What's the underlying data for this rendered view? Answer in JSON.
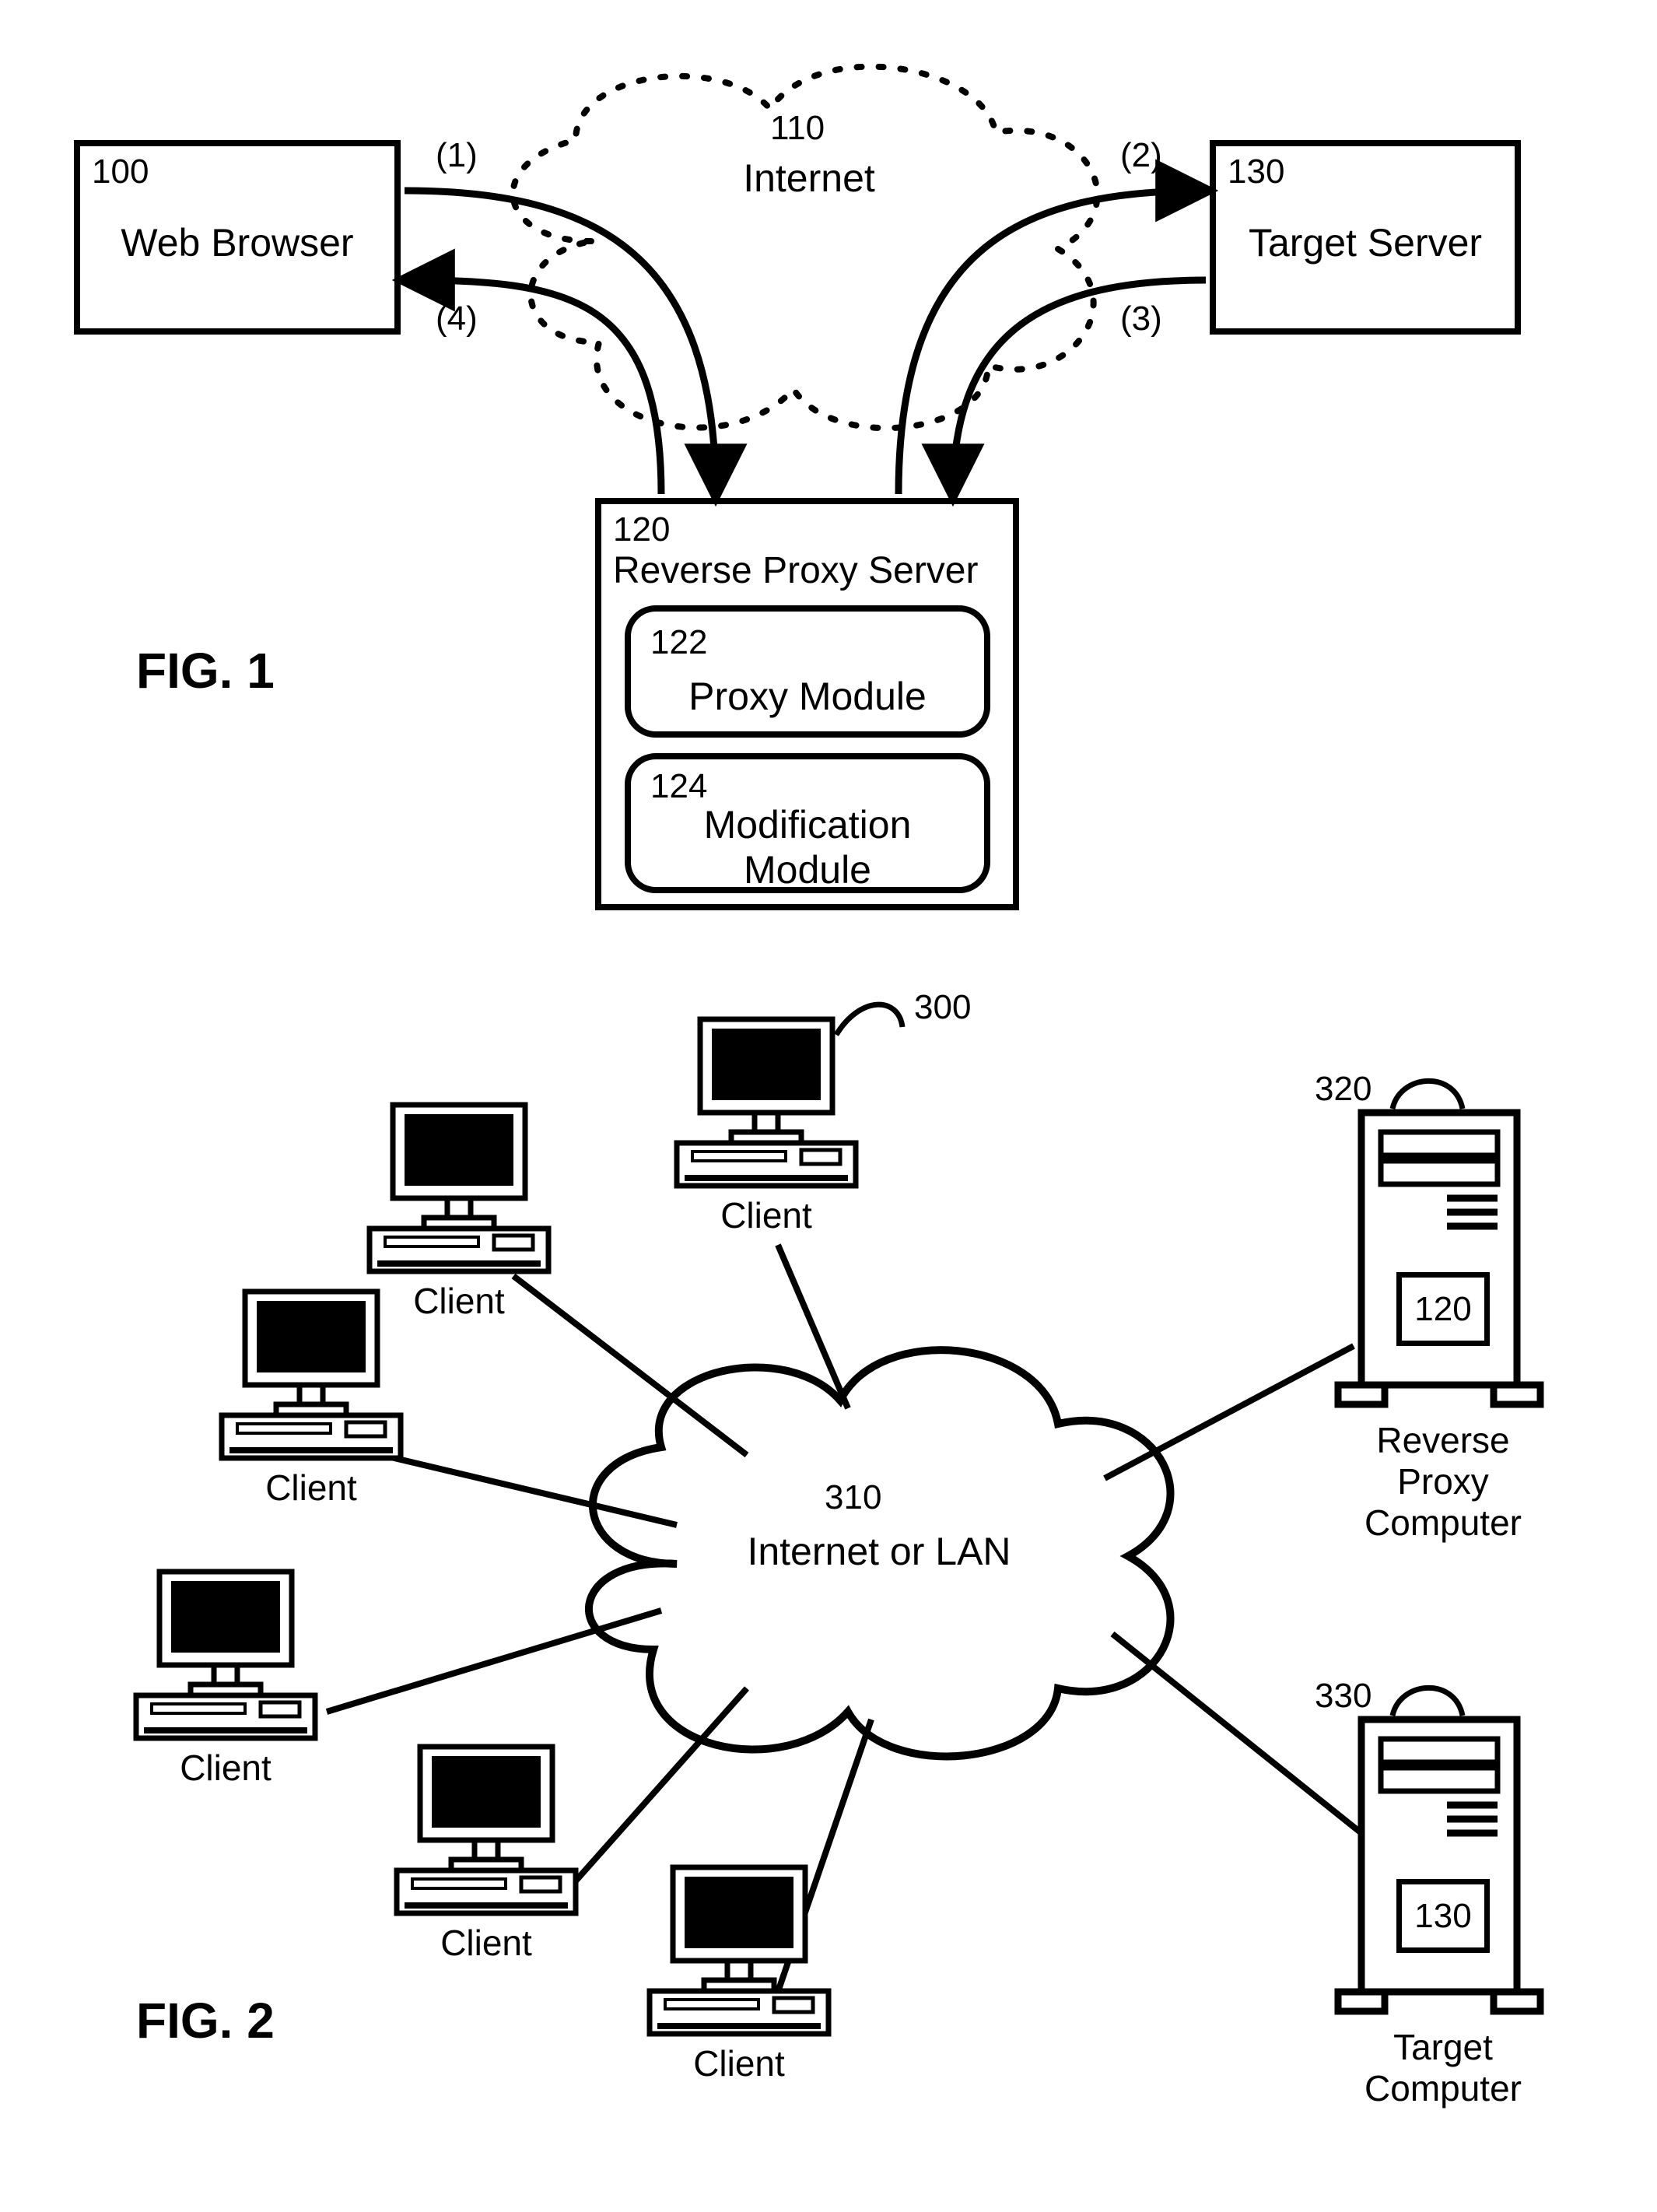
{
  "fig1": {
    "title": "FIG. 1",
    "browser": {
      "ref": "100",
      "label": "Web Browser"
    },
    "target": {
      "ref": "130",
      "label": "Target Server"
    },
    "cloud": {
      "ref": "110",
      "label": "Internet"
    },
    "proxy": {
      "ref": "120",
      "label": "Reverse Proxy Server"
    },
    "mod1": {
      "ref": "122",
      "label": "Proxy Module"
    },
    "mod2": {
      "ref": "124",
      "label": "Modification\nModule"
    },
    "steps": {
      "s1": "(1)",
      "s2": "(2)",
      "s3": "(3)",
      "s4": "(4)"
    }
  },
  "fig2": {
    "title": "FIG. 2",
    "cloud": {
      "ref": "310",
      "label": "Internet or LAN"
    },
    "clients": {
      "ref": "300",
      "label": "Client"
    },
    "proxy": {
      "ref": "320",
      "label": "Reverse\nProxy\nComputer",
      "innerRef": "120"
    },
    "target": {
      "ref": "330",
      "label": "Target\nComputer",
      "innerRef": "130"
    }
  }
}
